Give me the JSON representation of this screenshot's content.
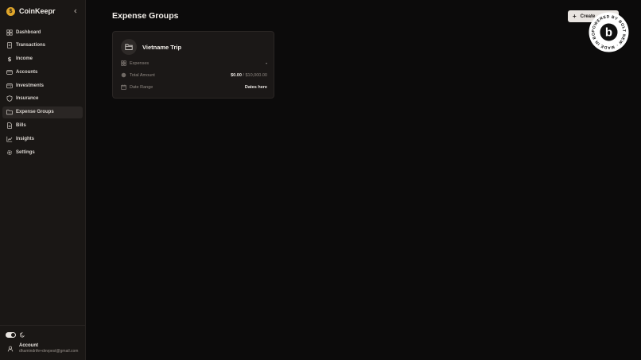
{
  "sidebar": {
    "brand": "CoinKeepr",
    "items": [
      {
        "label": "Dashboard",
        "icon": "dashboard-icon"
      },
      {
        "label": "Transactions",
        "icon": "receipt-icon"
      },
      {
        "label": "Income",
        "icon": "dollar-icon"
      },
      {
        "label": "Accounts",
        "icon": "credit-card-icon"
      },
      {
        "label": "Investments",
        "icon": "wallet-icon"
      },
      {
        "label": "Insurance",
        "icon": "shield-icon"
      },
      {
        "label": "Expense Groups",
        "icon": "folder-icon",
        "active": true
      },
      {
        "label": "Bills",
        "icon": "document-icon"
      },
      {
        "label": "Insights",
        "icon": "chart-line-icon"
      },
      {
        "label": "Settings",
        "icon": "gear-icon"
      }
    ],
    "account": {
      "name": "Account",
      "email": "dhamindrife+devpest@gmail.com"
    }
  },
  "main": {
    "title": "Expense Groups",
    "create_label": "Create",
    "badge_text": "POWERED BY BOLT NEW · MADE IN BOLT NEW ·",
    "group": {
      "name": "Vietname Trip",
      "rows": [
        {
          "label": "Expenses",
          "value": "-",
          "icon": "grid-icon"
        },
        {
          "label": "Total Amount",
          "value": "$0.00",
          "value_suffix": "/ $10,000.00",
          "icon": "circle-icon"
        },
        {
          "label": "Date Range",
          "value": "Dates here",
          "icon": "calendar-icon"
        }
      ]
    }
  },
  "colors": {
    "background": "#0c0b0b",
    "sidebar": "#1a1715",
    "accent_logo": "#e0a62a",
    "button_bg": "#e8e4e0"
  }
}
